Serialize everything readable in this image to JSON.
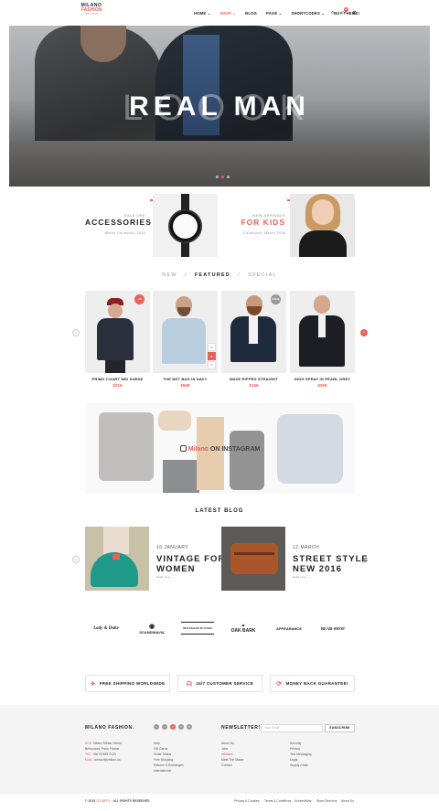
{
  "header": {
    "logo_top": "MILANO",
    "logo_main": "FASHION",
    "logo_sub": "·EST 2015·",
    "nav": [
      "HOME ⌄",
      "SHOP ⌄",
      "BLOG",
      "PAGE ⌄",
      "SHORTCODES ⌄",
      "BUY THEME!"
    ],
    "cart_count": "0"
  },
  "hero": {
    "ghost": "LOOOK",
    "title": "REAL MAN"
  },
  "promos": [
    {
      "kicker": "SALE OFF",
      "title": "ACCESSORIES",
      "caption": "Watch Collection 2016"
    },
    {
      "kicker": "NEW ARRIVALS",
      "title": "FOR KIDS",
      "caption": "Collection: March 2016"
    }
  ],
  "tabs": {
    "new": "NEW",
    "featured": "FEATURED",
    "special": "SPECIAL",
    "sep": "/"
  },
  "products": [
    {
      "name": "PRIMO COURT MID SUEDE",
      "price": "$216",
      "badge": "-10"
    },
    {
      "name": "THE NET BAG IN NAVY",
      "price": "$568",
      "badge": ""
    },
    {
      "name": "WAVE RIPPED STRAIGHT",
      "price": "$156",
      "badge": "SALE"
    },
    {
      "name": "HIGH SPRAY IN PEARL GREY",
      "price": "$265",
      "badge": ""
    }
  ],
  "instagram": {
    "brand": "Milano",
    "text": " ON INSTAGRAM"
  },
  "blog": {
    "section_title": "LATEST BLOG",
    "posts": [
      {
        "date": "16.JANUARY",
        "title_1": "VINTAGE FOR",
        "title_2": "WOMEN",
        "meta": "Read more →"
      },
      {
        "date": "12.MARCH",
        "title_1": "STREET STYLE",
        "title_2": "NEW 2016",
        "meta": "Read more →"
      }
    ]
  },
  "brands": [
    "Lady & Duke",
    "SCANDINAVIA",
    "MI CASA ES TU CASA",
    "OAK BARK",
    "APPEARANCE",
    "BEAR SHOP"
  ],
  "features": [
    "FREE SHIPPING WORLDWIDE",
    "24/7 CUSTOMER SERVICE",
    "MONEY BACK GUARANTEE!"
  ],
  "footer": {
    "brand": "MILANO FASHION.",
    "addr_label": "ADD:",
    "addr_1": "Milano Mirazz Street",
    "addr_2": "Belmonont, Paris France",
    "tel_label": "TEL:",
    "tel": "+66 93 555 2123",
    "mail_label": "MAIL:",
    "mail": "contact@zeikon.us",
    "col1": [
      "Help",
      "Gift Cards",
      "Order Status",
      "Free Shipping",
      "Returns & Exchanges",
      "International"
    ],
    "col2": [
      "About Us",
      "Jobs",
      "Affiliates",
      "Meet The Maker",
      "Contact"
    ],
    "newsletter_title": "NEWSLETTER!",
    "newsletter_placeholder": "Your Email",
    "subscribe": "SUBSCRIBE",
    "col3": [
      "Security",
      "Privacy",
      "Text Messaging",
      "Legal",
      "Supply Chain"
    ],
    "copyright_pre": "© 2015 ",
    "copyright_brand": "LEOBEEX",
    "copyright_post": " · ALL RIGHTS RESERVED",
    "bottom_links": [
      "Privacy & Cookies",
      "Terms & Conditions",
      "Accessibility",
      "Store Directory",
      "About Us"
    ]
  },
  "colors": {
    "accent": "#e8615a"
  }
}
